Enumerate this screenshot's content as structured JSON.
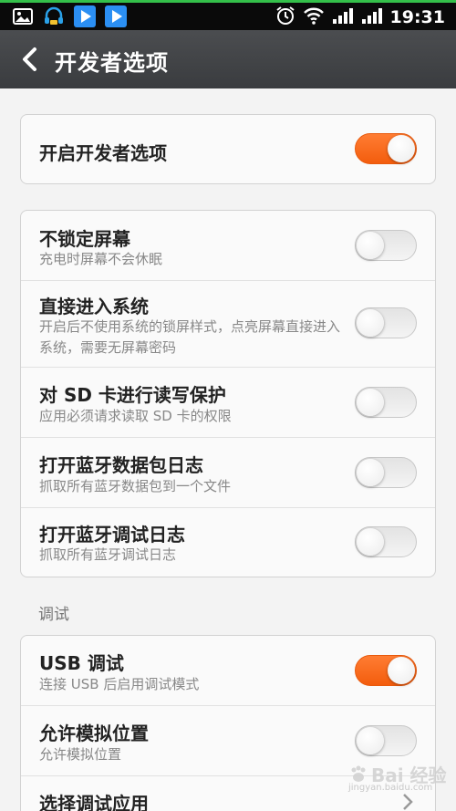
{
  "status_bar": {
    "time": "19:31",
    "left_icons": [
      "picture-icon",
      "headset-icon",
      "play-store-icon",
      "play-store-icon"
    ],
    "right_icons": [
      "alarm-icon",
      "wifi-icon",
      "signal-icon",
      "signal-icon"
    ]
  },
  "header": {
    "title": "开发者选项"
  },
  "master": {
    "label": "开启开发者选项",
    "on": true
  },
  "settings": [
    {
      "title": "不锁定屏幕",
      "subtitle": "充电时屏幕不会休眠",
      "on": false
    },
    {
      "title": "直接进入系统",
      "subtitle": "开启后不使用系统的锁屏样式，点亮屏幕直接进入系统，需要无屏幕密码",
      "on": false
    },
    {
      "title": "对 SD 卡进行读写保护",
      "subtitle": "应用必须请求读取 SD 卡的权限",
      "on": false
    },
    {
      "title": "打开蓝牙数据包日志",
      "subtitle": "抓取所有蓝牙数据包到一个文件",
      "on": false
    },
    {
      "title": "打开蓝牙调试日志",
      "subtitle": "抓取所有蓝牙调试日志",
      "on": false
    }
  ],
  "debug": {
    "section_label": "调试",
    "items": [
      {
        "title": "USB 调试",
        "subtitle": "连接 USB 后启用调试模式",
        "on": true
      },
      {
        "title": "允许模拟位置",
        "subtitle": "允许模拟位置",
        "on": false
      },
      {
        "title": "选择调试应用"
      }
    ]
  },
  "watermark": {
    "text": "Bai 经验",
    "sub": "jingyan.baidu.com"
  },
  "colors": {
    "accent": "#f56a1c",
    "status_bar": "#0a0a0a",
    "title_bar": "#434548",
    "background": "#f3f3f3"
  }
}
